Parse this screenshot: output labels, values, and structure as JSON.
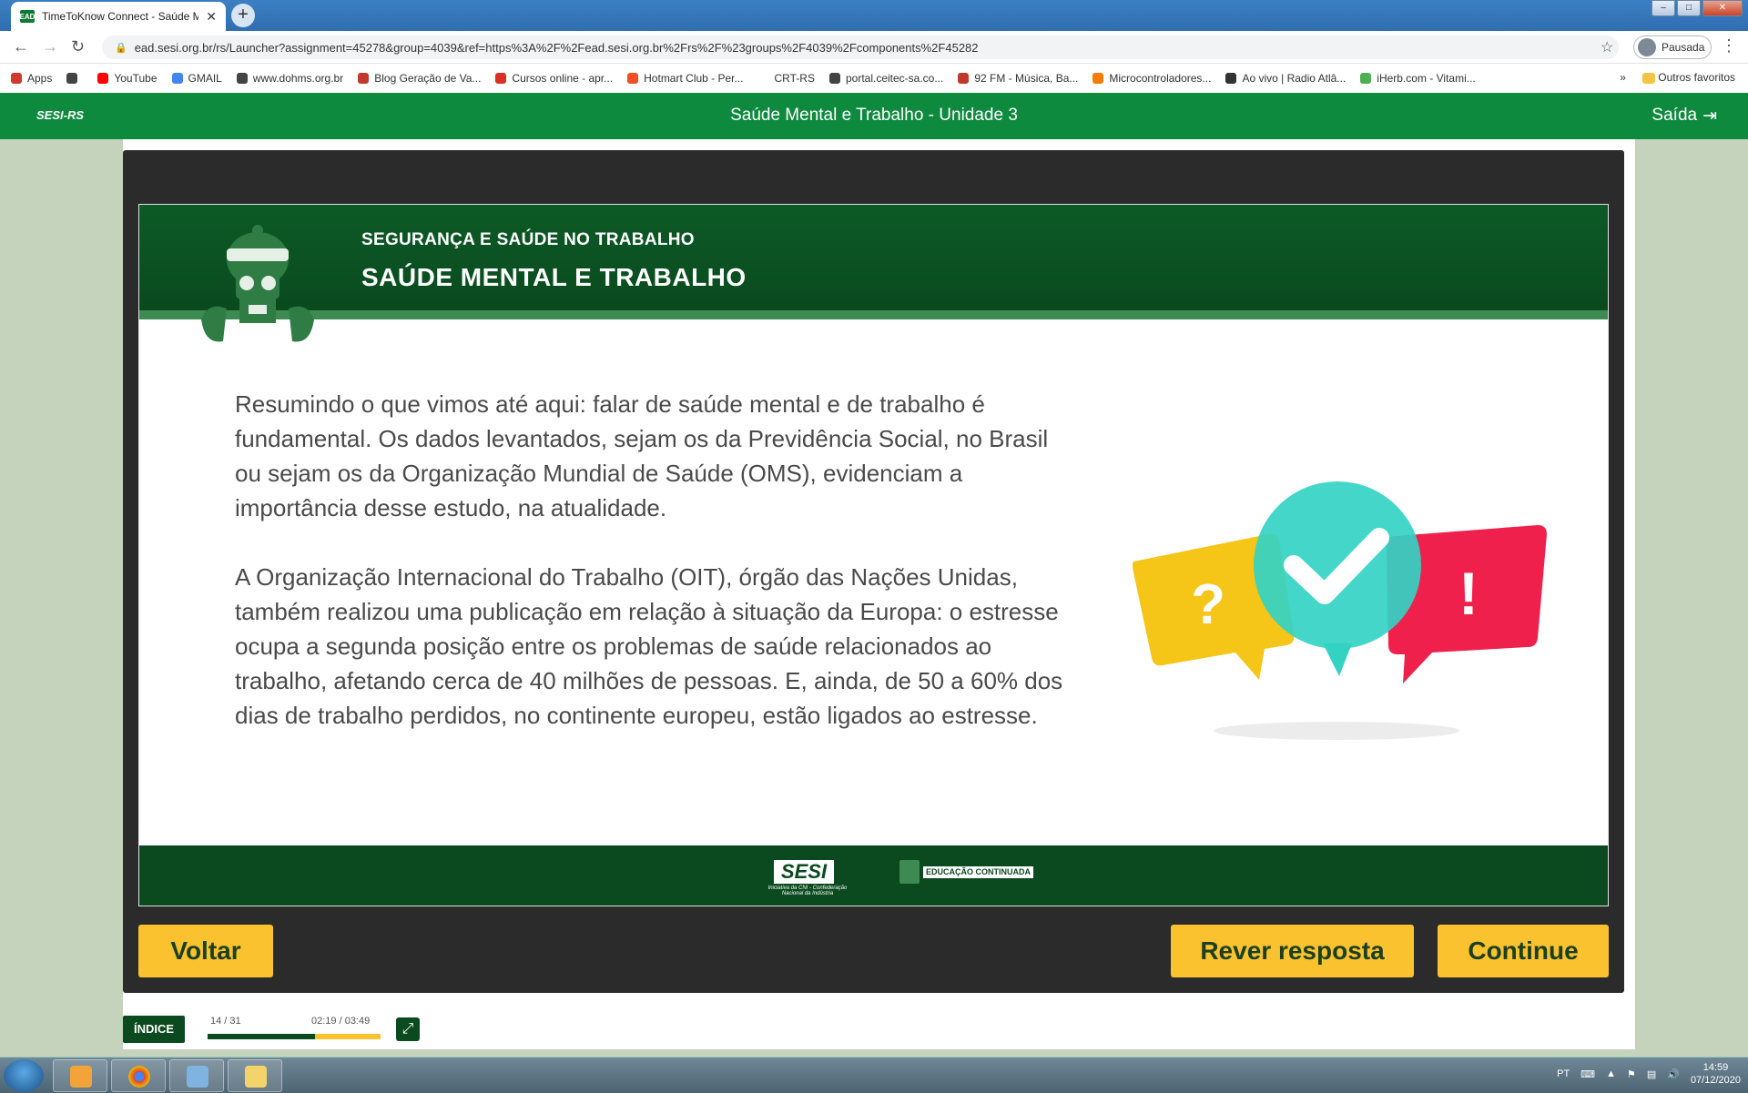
{
  "browser": {
    "tab_title": "TimeToKnow Connect - Saúde Mental",
    "tab_favicon": "EAD",
    "url": "ead.sesi.org.br/rs/Launcher?assignment=45278&group=4039&ref=https%3A%2F%2Fead.sesi.org.br%2Frs%2F%23groups%2F4039%2Fcomponents%2F45282",
    "profile_label": "Pausada",
    "bookmarks": [
      {
        "label": "Apps",
        "color": "#d0392b"
      },
      {
        "label": "",
        "color": "#444444"
      },
      {
        "label": "YouTube",
        "color": "#ff0000"
      },
      {
        "label": "GMAIL",
        "color": "#4285f4"
      },
      {
        "label": "www.dohms.org.br",
        "color": "#444444"
      },
      {
        "label": "Blog Geração de Va...",
        "color": "#c0392b"
      },
      {
        "label": "Cursos online - apr...",
        "color": "#d93025"
      },
      {
        "label": "Hotmart Club - Per...",
        "color": "#f04e23"
      },
      {
        "label": "CRT-RS",
        "color": "#ffffff"
      },
      {
        "label": "portal.ceitec-sa.co...",
        "color": "#444444"
      },
      {
        "label": "92 FM - Música, Ba...",
        "color": "#c0392b"
      },
      {
        "label": "Microcontroladores...",
        "color": "#f57c00"
      },
      {
        "label": "Ao vivo | Radio Atlâ...",
        "color": "#333333"
      },
      {
        "label": "iHerb.com - Vitami...",
        "color": "#4caf50"
      }
    ],
    "bookmarks_more": "»",
    "other_bookmarks": "Outros favoritos"
  },
  "app": {
    "logo": "SESI-RS",
    "title": "Saúde Mental e Trabalho - Unidade 3",
    "exit_label": "Saída"
  },
  "slide": {
    "kicker": "SEGURANÇA E SAÚDE NO TRABALHO",
    "heading": "SAÚDE MENTAL E TRABALHO",
    "paragraph1": "Resumindo o que vimos até aqui: falar de saúde mental e de trabalho é fundamental. Os dados levantados, sejam os da Previdência Social, no Brasil ou sejam os da Organização Mundial de Saúde (OMS), evidenciam a importância desse estudo, na atualidade.",
    "paragraph2": "A Organização Internacional do Trabalho (OIT), órgão das Nações Unidas, também realizou uma publicação em relação à situação da Europa: o estresse ocupa a segunda posição entre os problemas de saúde relacionados ao trabalho, afetando cerca de 40 milhões de pessoas. E, ainda, de 50 a 60% dos dias de trabalho perdidos, no continente europeu, estão ligados ao estresse.",
    "illustration": {
      "question_mark": "?",
      "exclamation_mark": "!",
      "colors": {
        "yellow": "#f5c518",
        "teal": "#33d3c4",
        "red": "#f0204c"
      }
    },
    "footer": {
      "sesi_logo": "SESI",
      "sesi_sub": "Iniciativa da CNI - Confederação Nacional da Indústria",
      "edu_logo": "EDUCAÇÃO CONTINUADA"
    }
  },
  "controls": {
    "back": "Voltar",
    "review": "Rever resposta",
    "continue": "Continue",
    "index": "ÍNDICE",
    "page_count": "14 / 31",
    "time": "02:19 / 03:49",
    "progress": 0.62
  },
  "taskbar": {
    "lang": "PT",
    "time": "14:59",
    "date": "07/12/2020"
  },
  "colors": {
    "brand_green": "#0e8a3f",
    "dark_green": "#0a4a1e",
    "button_yellow": "#f9c22e"
  }
}
